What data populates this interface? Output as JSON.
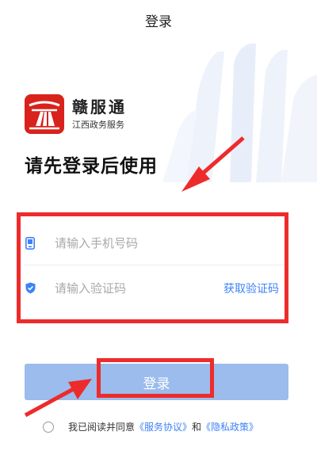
{
  "header": {
    "title": "登录"
  },
  "brand": {
    "name": "赣服通",
    "subtitle": "江西政务服务"
  },
  "headline": "请先登录后使用",
  "form": {
    "phone_placeholder": "请输入手机号码",
    "code_placeholder": "请输入验证码",
    "get_code_label": "获取验证码",
    "submit_label": "登录"
  },
  "agreement": {
    "prefix": "我已阅读并同意",
    "service_link": "《服务协议》",
    "conjunction": "和",
    "privacy_link": "《隐私政策》",
    "checked": false
  },
  "colors": {
    "brand_red": "#d9221c",
    "accent_blue": "#3e82f7",
    "button_bg": "#9bbcec",
    "annotation_red": "#ee2b2b"
  },
  "icons": {
    "phone": "phone-icon",
    "shield": "shield-check-icon"
  }
}
